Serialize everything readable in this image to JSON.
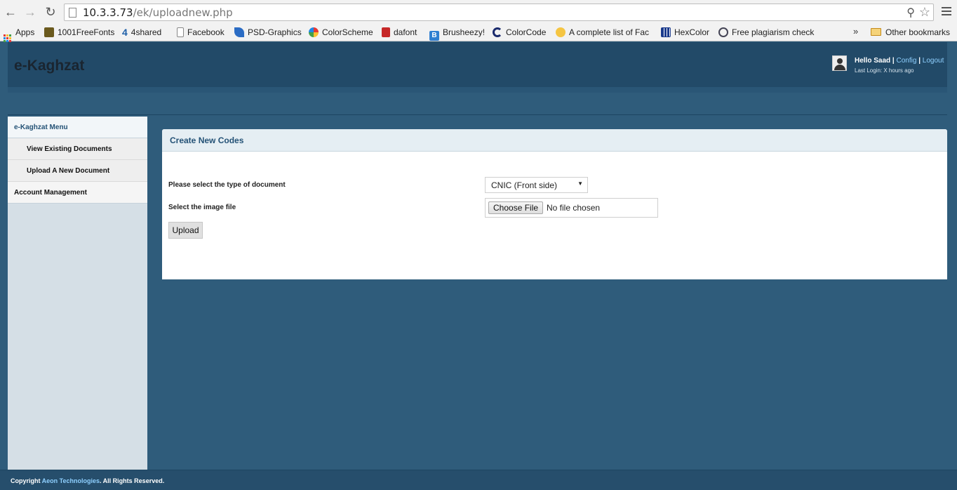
{
  "browser": {
    "url_host": "10.3.3.73",
    "url_path": "/ek/uploadnew.php",
    "bookmarks": [
      {
        "label": "Apps",
        "icon": "apps-grid-icon"
      },
      {
        "label": "1001FreeFonts",
        "icon": "1001freefonts-icon"
      },
      {
        "label": "4shared",
        "icon": "4shared-icon"
      },
      {
        "label": "Facebook",
        "icon": "page-icon"
      },
      {
        "label": "PSD-Graphics",
        "icon": "psd-graphics-icon"
      },
      {
        "label": "ColorScheme",
        "icon": "colorscheme-icon"
      },
      {
        "label": "dafont",
        "icon": "dafont-icon"
      },
      {
        "label": "Brusheezy!",
        "icon": "brusheezy-icon"
      },
      {
        "label": "ColorCode",
        "icon": "colorcode-icon"
      },
      {
        "label": "A complete list of Fac",
        "icon": "smiley-icon"
      },
      {
        "label": "HexColor",
        "icon": "hexcolor-icon"
      },
      {
        "label": "Free plagiarism check",
        "icon": "plagiarism-icon"
      }
    ],
    "overflow": "»",
    "other_bookmarks": "Other bookmarks"
  },
  "header": {
    "logo": "e-Kaghzat",
    "greeting": "Hello Saad",
    "separator": "|",
    "config_link": "Config",
    "logout_link": "Logout",
    "last_login": "Last Login: X hours ago"
  },
  "sidebar": {
    "title": "e-Kaghzat Menu",
    "items": [
      {
        "label": "View Existing Documents"
      },
      {
        "label": "Upload A New Document"
      }
    ],
    "section": "Account Management"
  },
  "panel": {
    "title": "Create New Codes",
    "doc_type_label": "Please select the type of document",
    "doc_type_value": "CNIC (Front side)",
    "image_label": "Select the image file",
    "choose_file": "Choose File",
    "file_status": "No file chosen",
    "upload_button": "Upload"
  },
  "footer": {
    "prefix": "Copyright ",
    "company": "Aeon Technologies",
    "suffix": ". All Rights Reserved."
  },
  "colors": {
    "page_bg": "#2f5c7b",
    "header_bg": "#224a68",
    "link": "#8fd0ff",
    "panel_title": "#245276"
  }
}
